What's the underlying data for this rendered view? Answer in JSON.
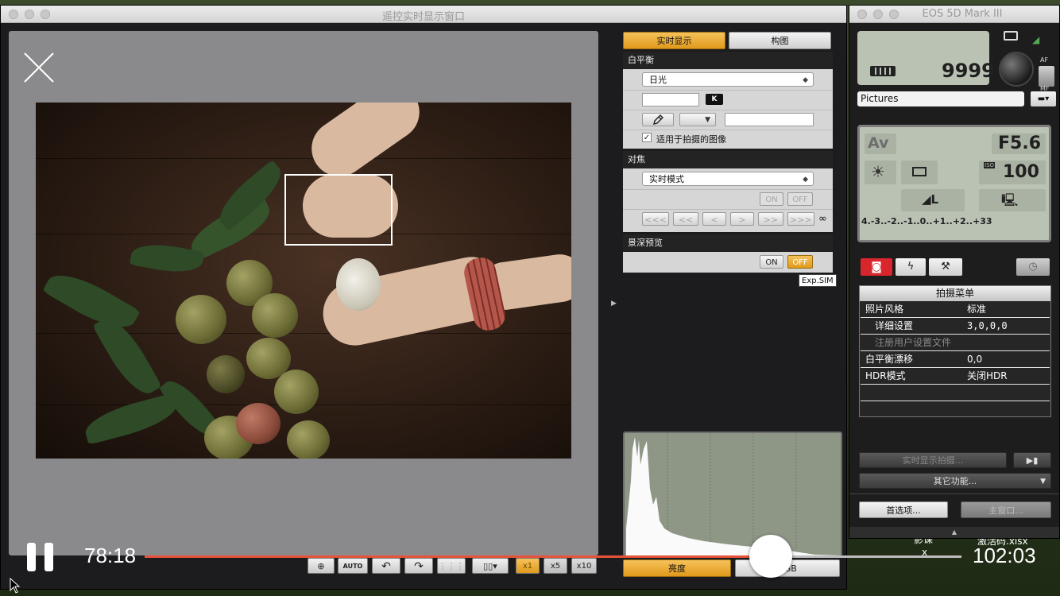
{
  "main_window": {
    "title": "遥控实时显示窗口"
  },
  "right_panel": {
    "tabs": [
      {
        "label": "实时显示",
        "active": true
      },
      {
        "label": "构图",
        "active": false
      }
    ],
    "white_balance": {
      "heading": "白平衡",
      "mode": "日光",
      "kelvin_badge": "K",
      "apply_checkbox_label": "适用于拍摄的图像",
      "apply_checked": true
    },
    "focus": {
      "heading": "对焦",
      "mode": "实时模式",
      "on_label": "ON",
      "off_label": "OFF",
      "step_buttons": [
        "<<<",
        "<<",
        "<",
        ">",
        ">>",
        ">>>"
      ],
      "infinity": "∞"
    },
    "dof_preview": {
      "heading": "景深预览",
      "on_label": "ON",
      "off_label": "OFF",
      "off_active": true
    },
    "exp_sim_badge": "Exp.SIM",
    "histogram_tabs": [
      "亮度",
      "RGB"
    ]
  },
  "bottom_toolbar": {
    "auto_label": "AUTO",
    "zoom_options": [
      "x1",
      "x5",
      "x10"
    ],
    "zoom_selected": "x1"
  },
  "camera_window": {
    "title": "EOS 5D Mark III",
    "shots_remaining": "9999",
    "af_label": "AF",
    "mf_label": "MF",
    "save_folder": "Pictures",
    "shooting_mode": "Av",
    "aperture": "F5.6",
    "iso_label": "ISO",
    "iso_value": "100",
    "quality": "◢L",
    "exposure_scale": "-3..-2..-1..0..+1..+2..+3",
    "exposure_scale_ends": [
      "4.",
      "3"
    ],
    "menu": {
      "title": "拍摄菜单",
      "rows": [
        {
          "key": "照片风格",
          "value": "标准",
          "indent": false,
          "disabled": false
        },
        {
          "key": "详细设置",
          "value": "3,0,0,0",
          "indent": true,
          "disabled": false
        },
        {
          "key": "注册用户设置文件",
          "value": "",
          "indent": true,
          "disabled": true
        },
        {
          "key": "白平衡漂移",
          "value": "0,0",
          "indent": false,
          "disabled": false
        },
        {
          "key": "HDR模式",
          "value": "关闭HDR",
          "indent": false,
          "disabled": false
        }
      ]
    },
    "live_view_shoot": "实时显示拍摄...",
    "other_functions": "其它功能...",
    "preferences": "首选项...",
    "main_window_btn": "主窗口..."
  },
  "desktop": {
    "file_label": "激活码.xlsx",
    "file_label_partial": "影课",
    "file_label_partial2": "x"
  },
  "video_player": {
    "current_time": "78:18",
    "total_time": "102:03",
    "progress_fraction": 0.767
  },
  "colors": {
    "accent_orange": "#f0a830",
    "seek_red": "#e8523a",
    "lcd_green": "#b9c2b3",
    "camera_red": "#d9262c"
  }
}
